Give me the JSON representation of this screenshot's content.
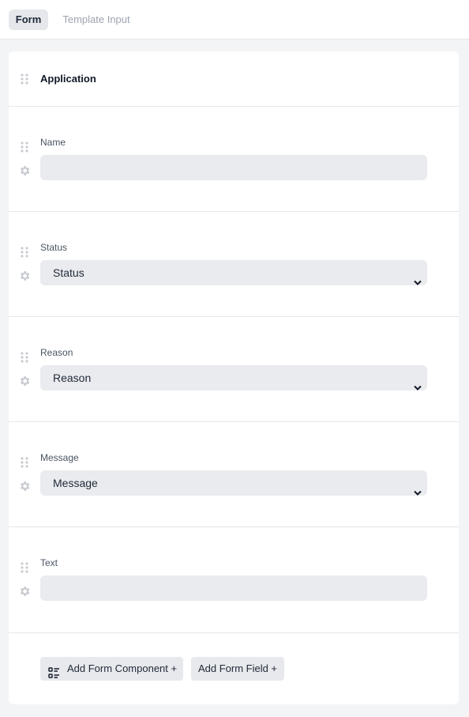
{
  "tabs": [
    {
      "label": "Form",
      "active": true
    },
    {
      "label": "Template Input",
      "active": false
    }
  ],
  "form": {
    "title": "Application",
    "fields": [
      {
        "label": "Name",
        "type": "input",
        "value": ""
      },
      {
        "label": "Status",
        "type": "select",
        "selected": "Status"
      },
      {
        "label": "Reason",
        "type": "select",
        "selected": "Reason"
      },
      {
        "label": "Message",
        "type": "select",
        "selected": "Message"
      },
      {
        "label": "Text",
        "type": "input",
        "value": ""
      }
    ]
  },
  "actions": {
    "add_component_label": "Add Form Component +",
    "add_field_label": "Add Form Field +"
  },
  "icons": {
    "drag": "drag-handle-icon",
    "settings": "gear-icon",
    "component": "checklist-icon",
    "select": "chevron-down-icon"
  },
  "colors": {
    "page_bg": "#f3f4f6",
    "field_bg": "#eaebee",
    "icon": "#c9ccd1"
  }
}
